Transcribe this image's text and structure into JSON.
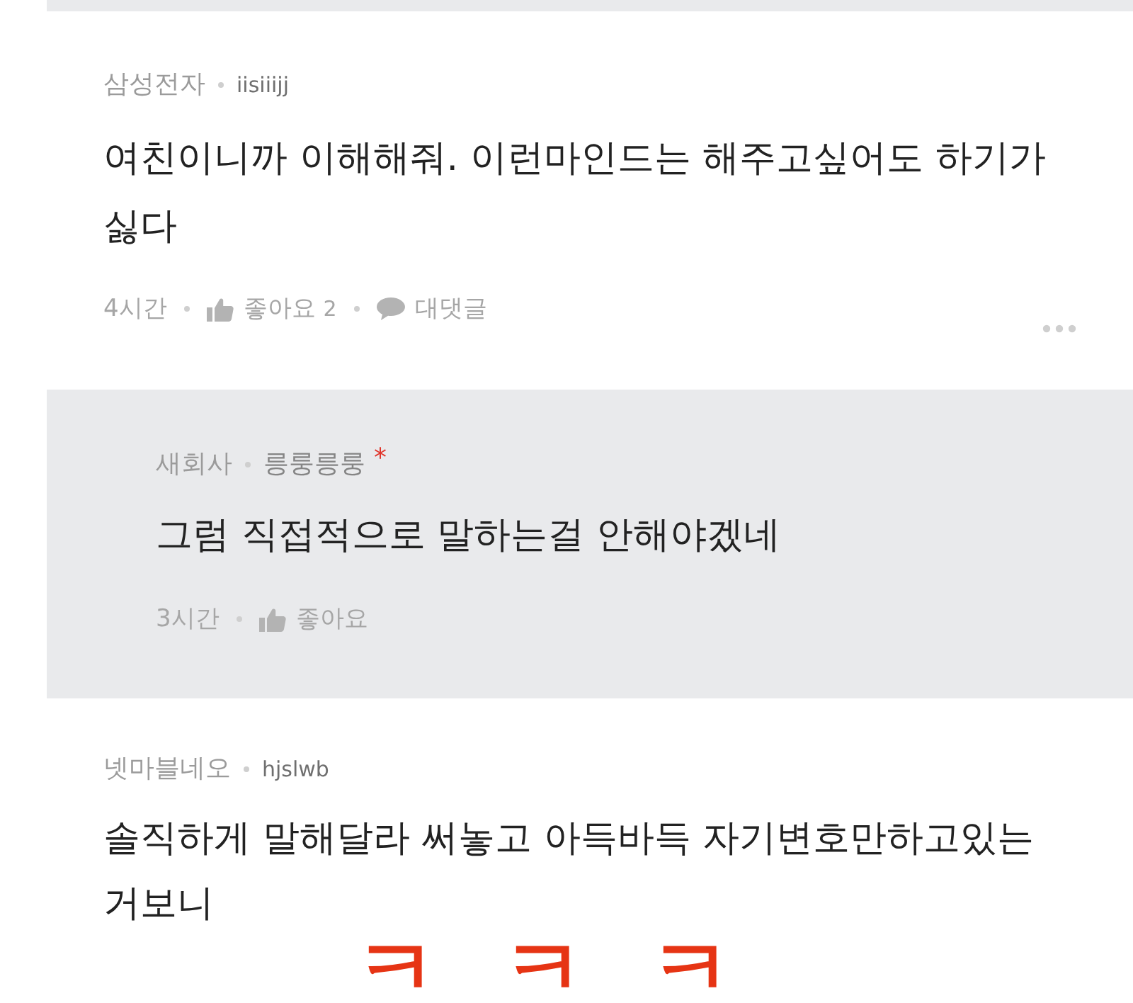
{
  "comments": [
    {
      "kind": "comment",
      "company": "삼성전자",
      "username": "iisiiijj",
      "text": "여친이니까 이해해줘. 이런마인드는 해주고싶어도 하기가 싫다",
      "time": "4시간",
      "like_label": "좋아요",
      "like_count": "2",
      "reply_label": "대댓글",
      "menu": true
    },
    {
      "kind": "reply",
      "company": "새회사",
      "username": "릉룽릉룽",
      "author_mark": "*",
      "text": "그럼 직접적으로 말하는걸 안해야겠네",
      "time": "3시간",
      "like_label": "좋아요",
      "menu": false
    },
    {
      "kind": "comment",
      "company": "넷마블네오",
      "username": "hjslwb",
      "text": "솔직하게 말해달라 써놓고 아득바득 자기변호만하고있는 거보니",
      "annotation": "ㅋㅋㅋ"
    }
  ]
}
